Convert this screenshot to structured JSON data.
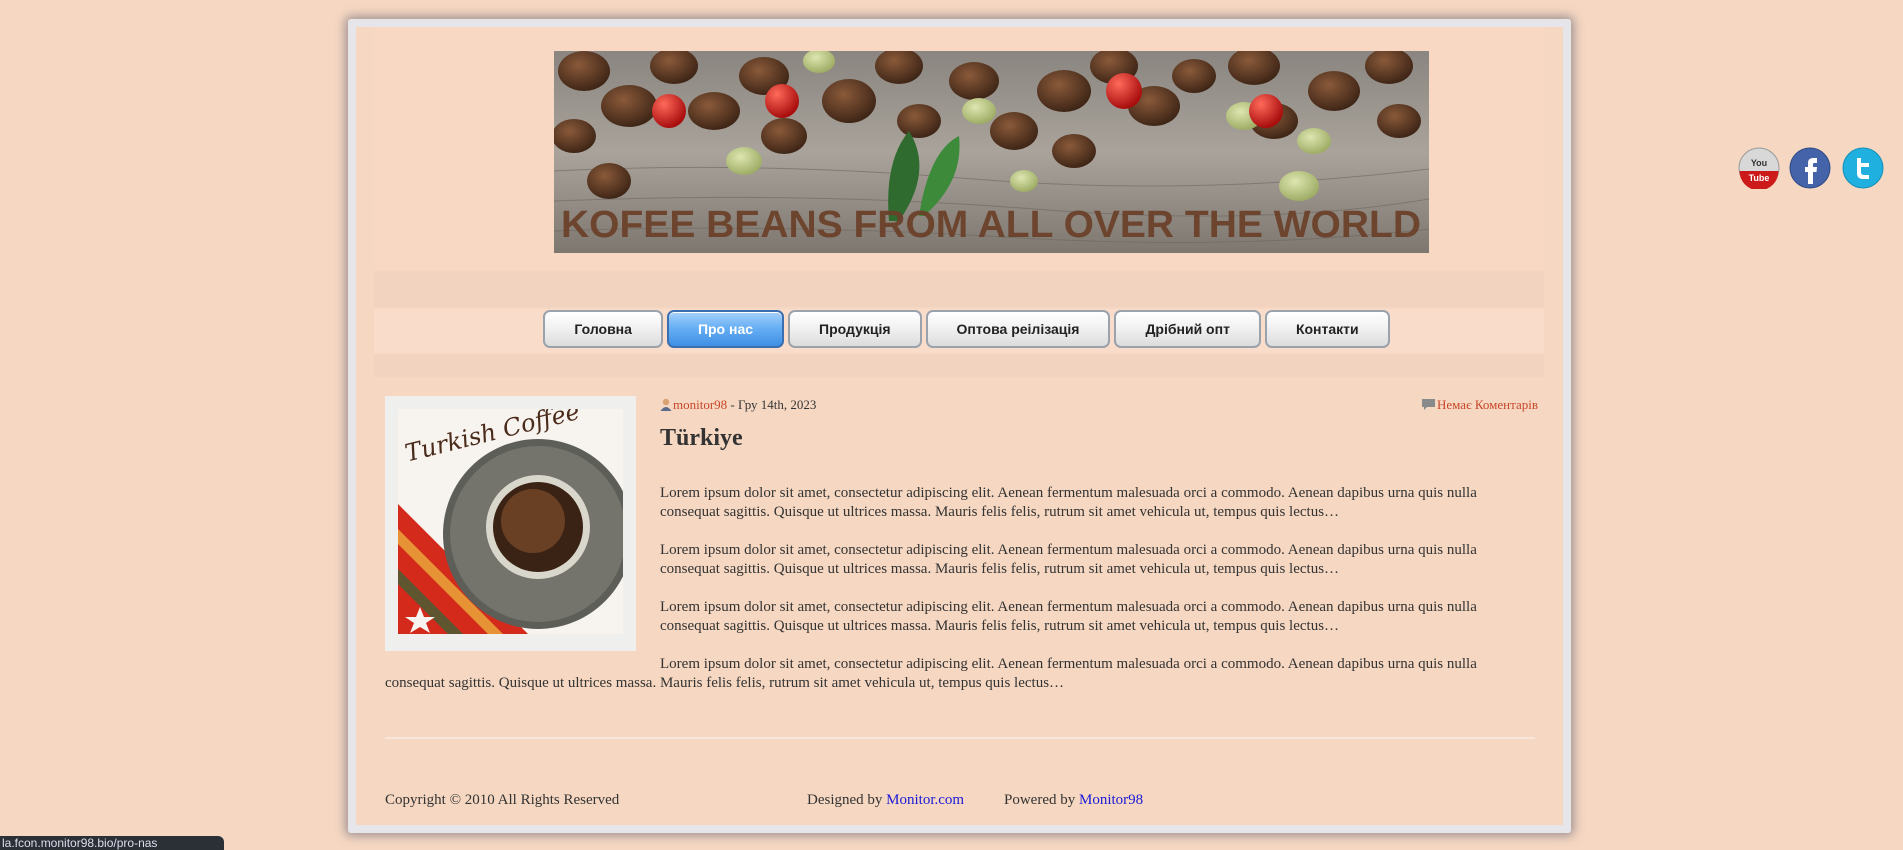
{
  "header": {
    "banner_text": "KOFEE BEANS FROM ALL OVER THE WORLD"
  },
  "nav": {
    "items": [
      {
        "label": "Головна",
        "active": false
      },
      {
        "label": "Про нас",
        "active": true
      },
      {
        "label": "Продукція",
        "active": false
      },
      {
        "label": "Оптова реілізація",
        "active": false
      },
      {
        "label": "Дрібний опт",
        "active": false
      },
      {
        "label": "Контакти",
        "active": false
      }
    ]
  },
  "post": {
    "image_caption": "Turkish Coffee",
    "author": "monitor98",
    "date_text": " - Гру 14th, 2023",
    "comments_label": "Немає Коментарів",
    "title": "Türkiye",
    "paragraphs": [
      "Lorem ipsum dolor sit amet, consectetur adipiscing elit. Aenean fermentum malesuada orci a commodo. Aenean dapibus urna quis nulla consequat sagittis. Quisque ut ultrices massa. Mauris felis felis, rutrum sit amet vehicula ut, tempus quis lectus…",
      "Lorem ipsum dolor sit amet, consectetur adipiscing elit. Aenean fermentum malesuada orci a commodo. Aenean dapibus urna quis nulla consequat sagittis. Quisque ut ultrices massa. Mauris felis felis, rutrum sit amet vehicula ut, tempus quis lectus…",
      "Lorem ipsum dolor sit amet, consectetur adipiscing elit. Aenean fermentum malesuada orci a commodo. Aenean dapibus urna quis nulla consequat sagittis. Quisque ut ultrices massa. Mauris felis felis, rutrum sit amet vehicula ut, tempus quis lectus…",
      "Lorem ipsum dolor sit amet, consectetur adipiscing elit. Aenean fermentum malesuada orci a commodo. Aenean dapibus urna quis nulla consequat sagittis. Quisque ut ultrices massa. Mauris felis felis, rutrum sit amet vehicula ut, tempus quis lectus…"
    ]
  },
  "footer": {
    "copyright": "Copyright © 2010 All Rights Reserved",
    "designed_prefix": "Designed by ",
    "designed_link": "Monitor.com",
    "powered_prefix": "Powered by ",
    "powered_link": "Monitor98"
  },
  "social": {
    "youtube_text": "You Tube",
    "icons": [
      "youtube-icon",
      "facebook-icon",
      "twitter-icon"
    ]
  },
  "status_bar": {
    "url": "la.fcon.monitor98.bio/pro-nas"
  }
}
